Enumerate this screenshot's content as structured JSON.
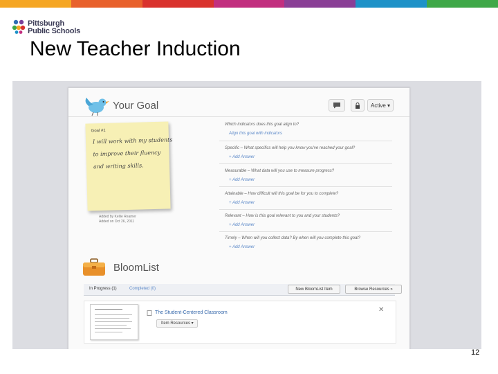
{
  "color_bar": [
    "#f5a623",
    "#e8612c",
    "#d9322d",
    "#c22f7f",
    "#8a3f96",
    "#1e92c8",
    "#3fa848"
  ],
  "logo": {
    "line1": "Pittsburgh",
    "line2": "Public Schools"
  },
  "slide": {
    "title": "New Teacher Induction",
    "page_number": "12"
  },
  "goal": {
    "title": "Your Goal",
    "buttons": {
      "comment_icon": "comment-icon",
      "lock_icon": "lock-icon",
      "status": "Active ▾"
    },
    "sticky": {
      "number": "Goal #1",
      "lines": [
        "I will work with my students",
        "to improve their fluency",
        "and writing skills."
      ]
    },
    "added_by": "Added by Kellie Reamer",
    "added_on": "Added on Oct 26, 2011",
    "smart": [
      {
        "question": "Which indicators does this goal align to?",
        "action": "Align this goal with indicators"
      },
      {
        "question": "Specific – What specifics will help you know you've reached your goal?",
        "action": "+ Add Answer"
      },
      {
        "question": "Measurable – What data will you use to measure progress?",
        "action": "+ Add Answer"
      },
      {
        "question": "Attainable – How difficult will this goal be for you to complete?",
        "action": "+ Add Answer"
      },
      {
        "question": "Relevant – How is this goal relevant to you and your students?",
        "action": "+ Add Answer"
      },
      {
        "question": "Timely – When will you collect data? By when will you complete this goal?",
        "action": "+ Add Answer"
      }
    ]
  },
  "bloomlist": {
    "title": "BloomList",
    "tabs": [
      "In Progress (1)",
      "Completed (0)"
    ],
    "buttons": [
      "New BloomList Item",
      "Browse Resources »"
    ],
    "item": {
      "title": "The Student-Centered Classroom",
      "status": "Item Resources ▾"
    }
  }
}
